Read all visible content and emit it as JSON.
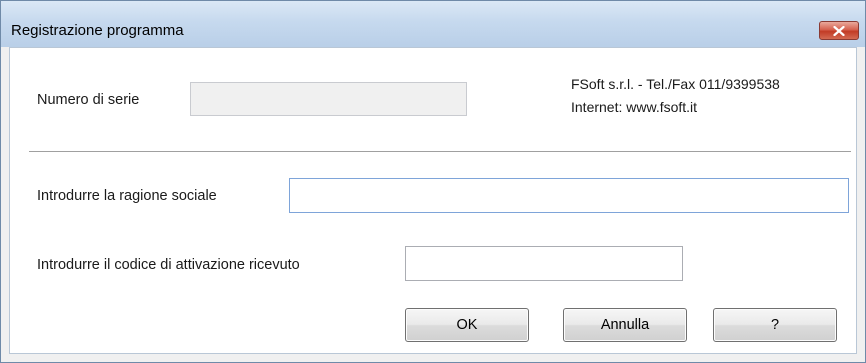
{
  "window": {
    "title": "Registrazione programma",
    "close_icon": "close-icon"
  },
  "form": {
    "serial_label": "Numero di serie",
    "serial_value": "",
    "company_info_line1": "FSoft s.r.l. - Tel./Fax 011/9399538",
    "company_info_line2": "Internet: www.fsoft.it",
    "business_name_label": "Introdurre la ragione sociale",
    "business_name_value": "",
    "activation_code_label": "Introdurre il codice di attivazione ricevuto",
    "activation_code_value": ""
  },
  "buttons": {
    "ok_label": "OK",
    "cancel_label": "Annulla",
    "help_label": "?"
  },
  "colors": {
    "titlebar": "#c6d9ee",
    "close_button": "#c23b26",
    "dialog_background": "#ffffff"
  }
}
